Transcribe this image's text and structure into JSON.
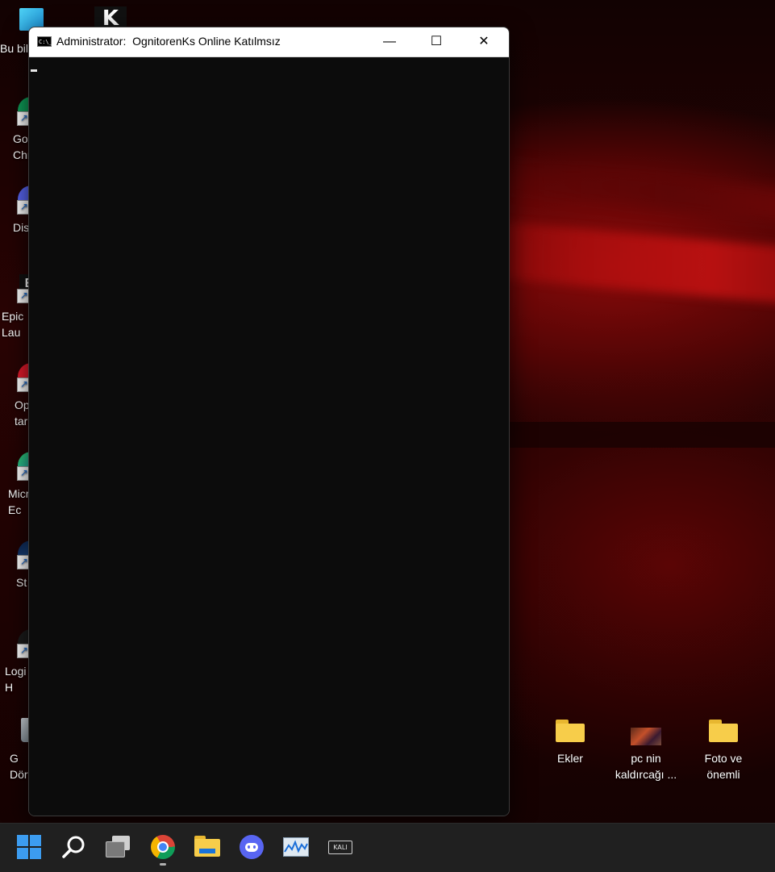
{
  "window": {
    "title": "Administrator:  OgnitorenKs Online Katılmsız",
    "app_icon_text": "C:\\_",
    "minimize_glyph": "—",
    "maximize_glyph": "☐",
    "close_glyph": "✕"
  },
  "desktop_left": {
    "items": [
      {
        "label": "Bu bil",
        "icon": "this-pc-icon"
      },
      {
        "label": "Go\nChr",
        "icon": "chrome-icon"
      },
      {
        "label": "Dis",
        "icon": "discord-icon"
      },
      {
        "label": "Epic\nLau",
        "icon": "epic-games-icon"
      },
      {
        "label": "Op\ntar",
        "icon": "opera-icon"
      },
      {
        "label": "Micr\nEc",
        "icon": "edge-icon"
      },
      {
        "label": "St",
        "icon": "steam-icon"
      },
      {
        "label": "Logi\nH",
        "icon": "logitech-icon"
      },
      {
        "label": "G\nDör",
        "icon": "recycle-bin-icon"
      }
    ],
    "k_icon_text": "K"
  },
  "desktop_right": {
    "items": [
      {
        "label": "Ekler",
        "icon": "folder-icon"
      },
      {
        "label": "pc nin\nkaldırcağı ...",
        "icon": "image-thumbnail-icon"
      },
      {
        "label": "Foto ve\nönemli",
        "icon": "folder-icon"
      }
    ]
  },
  "taskbar": {
    "items": [
      "start-icon",
      "search-icon",
      "task-view-icon",
      "chrome-icon",
      "file-explorer-icon",
      "discord-icon",
      "resource-monitor-icon",
      "kali-icon"
    ],
    "kali_label": "KALI"
  },
  "colors": {
    "console_bg": "#0c0c0c",
    "titlebar_bg": "#ffffff",
    "taskbar_bg": "#202020",
    "accent_red": "#d01414"
  }
}
